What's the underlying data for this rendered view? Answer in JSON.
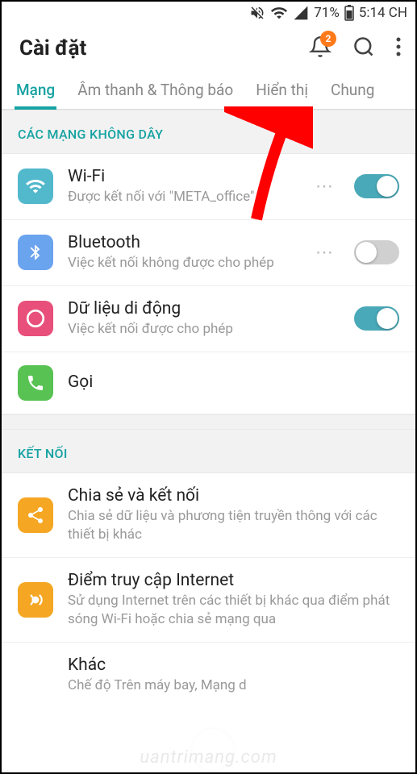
{
  "status": {
    "battery_pct": "71%",
    "time": "5:14 CH"
  },
  "header": {
    "title": "Cài đặt",
    "notif_count": "2"
  },
  "tabs": [
    {
      "label": "Mạng",
      "active": true
    },
    {
      "label": "Âm thanh & Thông báo",
      "active": false
    },
    {
      "label": "Hiển thị",
      "active": false
    },
    {
      "label": "Chung",
      "active": false
    }
  ],
  "sections": {
    "wireless": {
      "header": "CÁC MẠNG KHÔNG DÂY",
      "items": [
        {
          "key": "wifi",
          "title": "Wi-Fi",
          "sub": "Được kết nối với \"META_office\"",
          "toggle": "on",
          "icon_bg": "#52b8cc",
          "more": true
        },
        {
          "key": "bluetooth",
          "title": "Bluetooth",
          "sub": "Việc kết nối không được cho phép",
          "toggle": "off",
          "icon_bg": "#6aa3ee",
          "more": true
        },
        {
          "key": "mobile",
          "title": "Dữ liệu di động",
          "sub": "Việc kết nối được cho phép",
          "toggle": "on",
          "icon_bg": "#e84f7a",
          "more": false
        },
        {
          "key": "call",
          "title": "Gọi",
          "sub": "",
          "toggle": null,
          "icon_bg": "#58c253",
          "more": false
        }
      ]
    },
    "connect": {
      "header": "KẾT NỐI",
      "items": [
        {
          "key": "share",
          "title": "Chia sẻ và kết nối",
          "sub": "Chia sẻ dữ liệu và phương tiện truyền thông với các thiết bị khác",
          "icon_bg": "#f5a623"
        },
        {
          "key": "hotspot",
          "title": "Điểm truy cập Internet",
          "sub": "Sử dụng Internet trên các thiết bị khác qua điểm phát sóng Wi-Fi hoặc chia sẻ mạng qua",
          "icon_bg": "#f5a623"
        },
        {
          "key": "other",
          "title": "Khác",
          "sub": "Chế độ Trên máy bay, Mạng d",
          "icon_bg": ""
        }
      ]
    }
  },
  "watermark": "uantrimang.com",
  "more_dots": "⋯"
}
